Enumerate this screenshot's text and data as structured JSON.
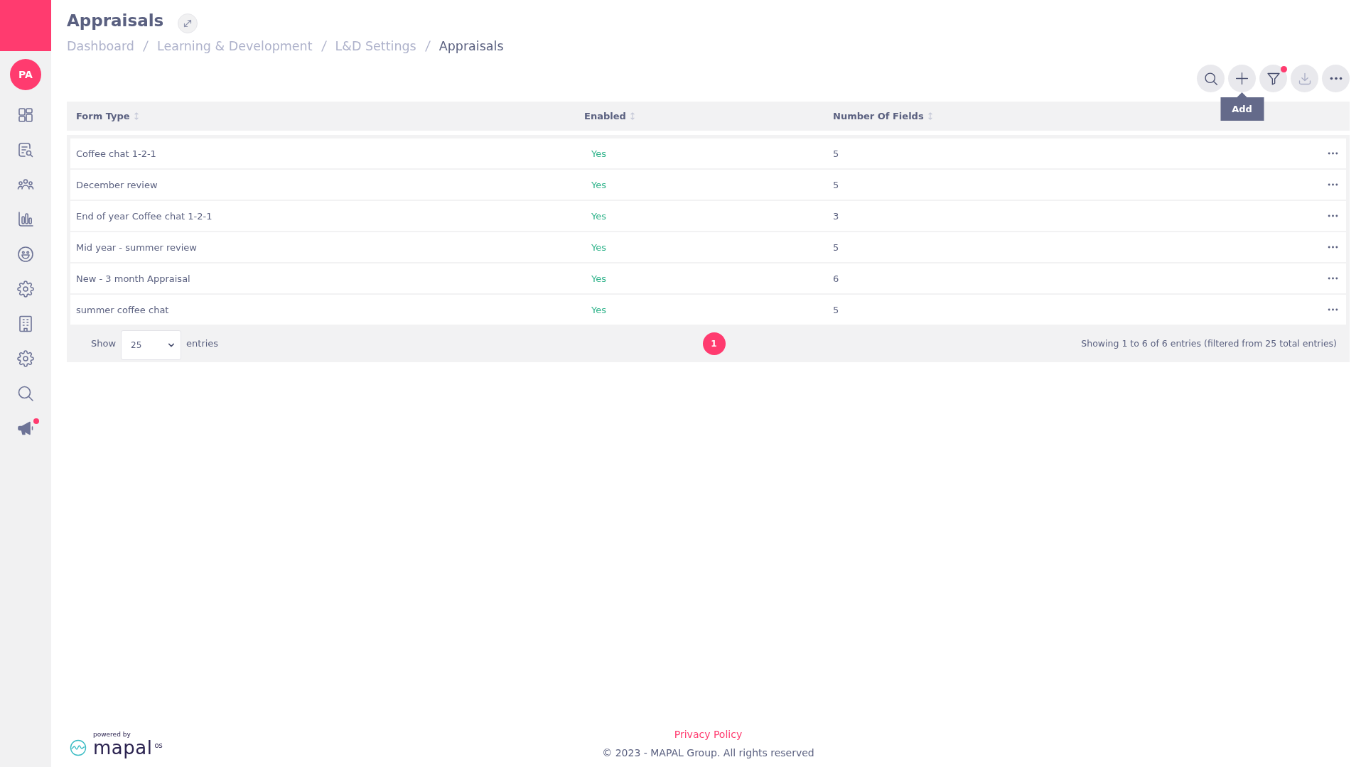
{
  "sidebar": {
    "avatar": "PA",
    "items": [
      {
        "kind": "dashboard",
        "notification": false
      },
      {
        "kind": "forms",
        "notification": false
      },
      {
        "kind": "people",
        "notification": false
      },
      {
        "kind": "chart",
        "notification": false
      },
      {
        "kind": "smiley",
        "notification": false
      },
      {
        "kind": "settings",
        "notification": false
      },
      {
        "kind": "building",
        "notification": false
      },
      {
        "kind": "settings",
        "notification": false
      },
      {
        "kind": "search",
        "notification": false
      },
      {
        "kind": "megaphone",
        "notification": true
      }
    ]
  },
  "header": {
    "title": "Appraisals",
    "breadcrumb": [
      {
        "label": "Dashboard",
        "current": false
      },
      {
        "label": "Learning & Development",
        "current": false
      },
      {
        "label": "L&D Settings",
        "current": false
      },
      {
        "label": "Appraisals",
        "current": true
      }
    ]
  },
  "toolbar": {
    "buttons": [
      {
        "kind": "search",
        "disabled": false,
        "notification": false
      },
      {
        "kind": "add",
        "disabled": false,
        "notification": false,
        "tooltip": "Add"
      },
      {
        "kind": "filter",
        "disabled": false,
        "notification": true
      },
      {
        "kind": "download",
        "disabled": true,
        "notification": false
      },
      {
        "kind": "more",
        "disabled": false,
        "notification": false
      }
    ]
  },
  "table": {
    "columns": [
      {
        "label": "Form Type",
        "sortable": true
      },
      {
        "label": "Enabled",
        "sortable": true
      },
      {
        "label": "Number Of Fields",
        "sortable": true
      }
    ],
    "rows": [
      {
        "form_type": "Coffee chat 1-2-1",
        "enabled": "Yes",
        "number_of_fields": "5"
      },
      {
        "form_type": "December review",
        "enabled": "Yes",
        "number_of_fields": "5"
      },
      {
        "form_type": "End of year Coffee chat 1-2-1",
        "enabled": "Yes",
        "number_of_fields": "3"
      },
      {
        "form_type": "Mid year - summer review",
        "enabled": "Yes",
        "number_of_fields": "5"
      },
      {
        "form_type": "New - 3 month Appraisal",
        "enabled": "Yes",
        "number_of_fields": "6"
      },
      {
        "form_type": "summer coffee chat",
        "enabled": "Yes",
        "number_of_fields": "5"
      }
    ]
  },
  "pagination": {
    "show_label": "Show",
    "page_size": "25",
    "entries_label": "entries",
    "pages": [
      {
        "label": "1",
        "selected": true
      }
    ],
    "info": "Showing 1 to 6 of 6 entries (filtered from 25 total entries)"
  },
  "footer": {
    "logo": {
      "powered_by": "powered by",
      "name": "mapal",
      "suffix": "os"
    },
    "privacy_link": "Privacy Policy",
    "copyright": "© 2023 - MAPAL Group. All rights reserved"
  }
}
